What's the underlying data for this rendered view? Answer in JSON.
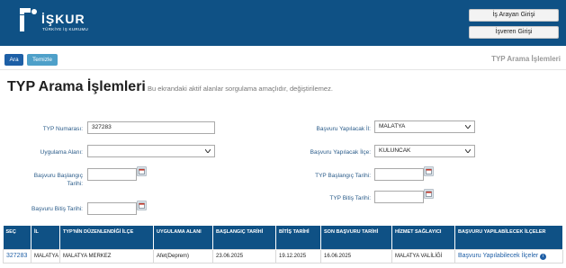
{
  "header": {
    "logo_name": "İŞKUR",
    "logo_sub": "TÜRKİYE İŞ KURUMU",
    "buttons": {
      "is_arayan": "İş Arayan Girişi",
      "isveren": "İşveren Girişi"
    },
    "bg_color": "#0f5185"
  },
  "toolbar": {
    "ara_label": "Ara",
    "temizle_label": "Temizle",
    "title": "TYP Arama İşlemleri"
  },
  "page": {
    "title": "TYP Arama İşlemleri",
    "subtitle": "Bu ekrandaki aktif alanlar sorgulama amaçlıdır, değiştirilemez."
  },
  "form": {
    "typ_numarasi": {
      "label": "TYP Numarası:",
      "value": "327283"
    },
    "uygulama_alani": {
      "label": "Uygulama Alanı:",
      "value": ""
    },
    "basvuru_baslangic": {
      "label_1": "Başvuru Başlangıç",
      "label_2": "Tarihi:",
      "value": ""
    },
    "basvuru_bitis": {
      "label": "Başvuru Bitiş Tarihi:",
      "value": ""
    },
    "basvuru_il": {
      "label": "Başvuru Yapılacak İl:",
      "value": "MALATYA"
    },
    "basvuru_ilce": {
      "label": "Başvuru Yapılacak İlçe:",
      "value": "KULUNCAK"
    },
    "typ_baslangic": {
      "label": "TYP Başlangıç Tarihi:",
      "value": ""
    },
    "typ_bitis": {
      "label": "TYP Bitiş Tarihi:",
      "value": ""
    }
  },
  "table": {
    "headers": [
      "SEÇ",
      "İL",
      "TYP'NİN DÜZENLENDİĞİ İLÇE",
      "UYGULAMA ALANI",
      "BAŞLANGIÇ TARİHİ",
      "BİTİŞ TARİHİ",
      "SON BAŞVURU TARİHİ",
      "HİZMET SAĞLAYICI",
      "BAŞVURU YAPILABİLECEK İLÇELER"
    ],
    "rows": [
      {
        "sec": "327283",
        "il": "MALATYA",
        "ilce": "MALATYA MERKEZ",
        "alan": "Afet(Deprem)",
        "baslangic": "23.06.2025",
        "bitis": "19.12.2025",
        "son_basvuru": "16.06.2025",
        "hizmet": "MALATYA VALİLİĞİ",
        "ilceler": "Başvuru Yapılabilecek İlçeler"
      }
    ]
  }
}
